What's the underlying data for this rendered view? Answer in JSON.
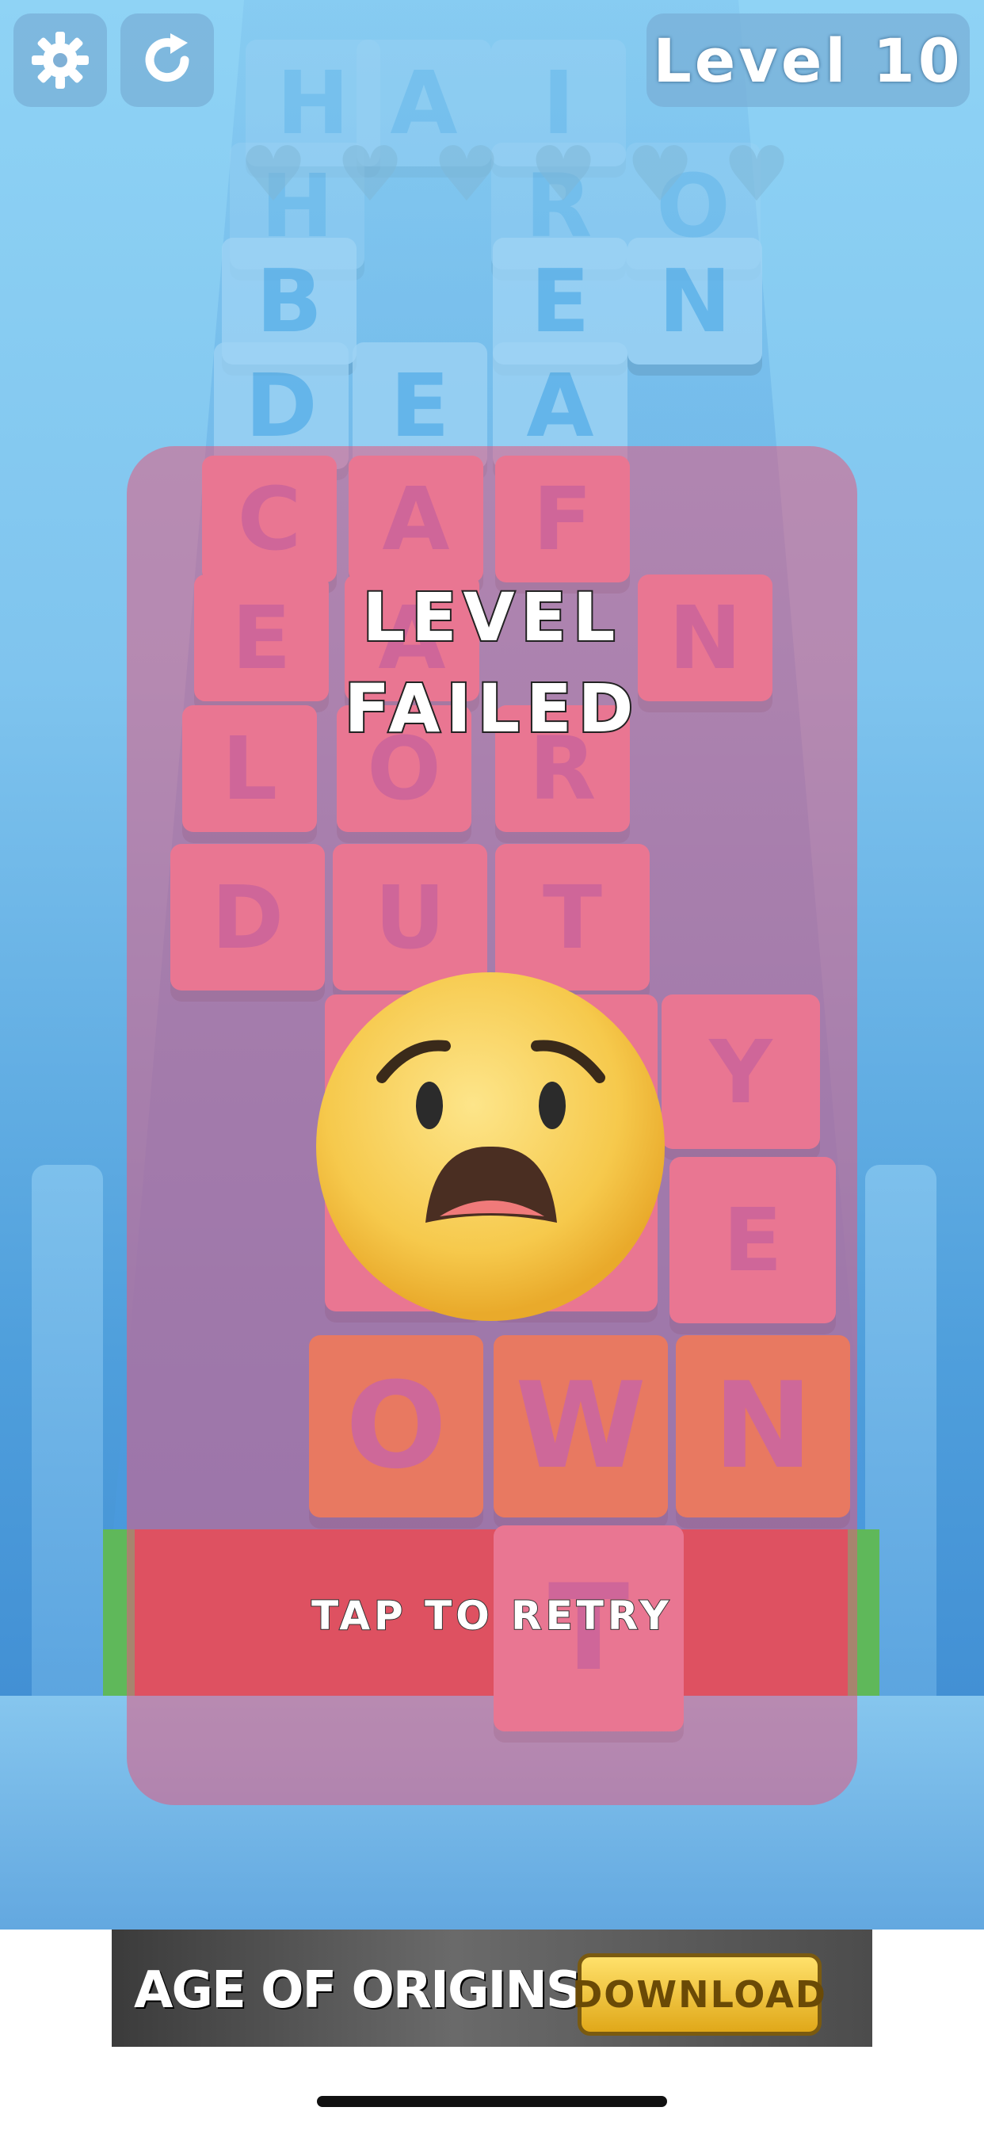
{
  "hud": {
    "settings_icon": "gear-icon",
    "restart_icon": "restart-icon",
    "level_label": "Level 10",
    "hearts": 6
  },
  "board": {
    "rows": [
      [
        "H",
        "A",
        "I"
      ],
      [
        "H",
        "R",
        "O"
      ],
      [
        "B",
        "E",
        "N"
      ],
      [
        "D",
        "E",
        "A"
      ],
      [
        "C",
        "A",
        "F"
      ],
      [
        "E",
        "A",
        "N"
      ],
      [
        "L",
        "O",
        "R"
      ],
      [
        "D",
        "U",
        "T"
      ],
      [
        "Y"
      ],
      [
        "E"
      ],
      [
        "O",
        "W",
        "N"
      ],
      [
        "T"
      ]
    ]
  },
  "result": {
    "title_line1": "LEVEL",
    "title_line2": "FAILED",
    "retry_label": "TAP TO RETRY",
    "emoji": "anguished-face"
  },
  "ad": {
    "title": "AGE OF ORIGINS",
    "cta": "DOWNLOAD"
  }
}
